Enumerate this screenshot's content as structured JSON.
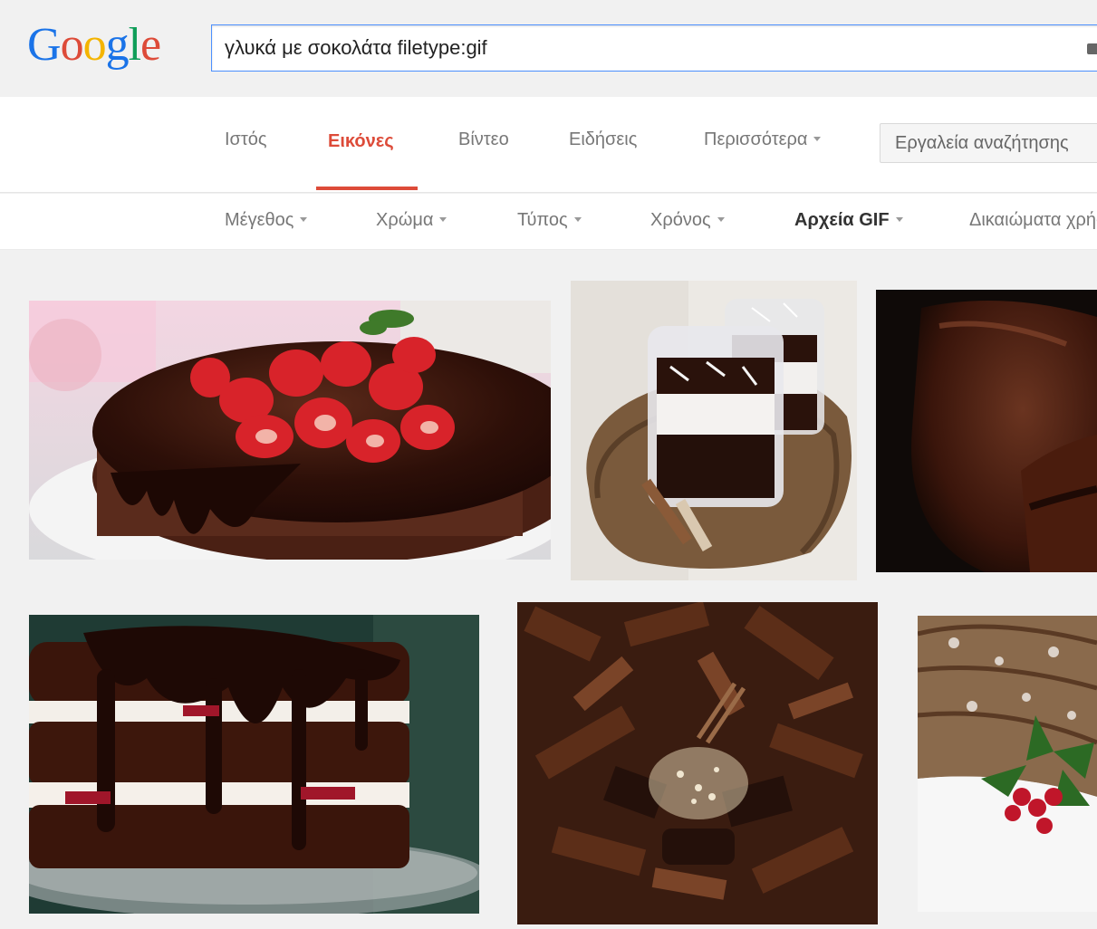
{
  "header": {
    "logo_letters": [
      "G",
      "o",
      "o",
      "g",
      "l",
      "e"
    ],
    "logo_colors": [
      "#1a73e8",
      "#dd4b39",
      "#f4b400",
      "#1a73e8",
      "#0f9d58",
      "#dd4b39"
    ],
    "search_query": "γλυκά με σοκολάτα filetype:gif"
  },
  "tabs": {
    "items": [
      {
        "label": "Ιστός"
      },
      {
        "label": "Εικόνες"
      },
      {
        "label": "Βίντεο"
      },
      {
        "label": "Ειδήσεις"
      },
      {
        "label": "Περισσότερα"
      }
    ],
    "active_index": 1,
    "tools_label": "Εργαλεία αναζήτησης"
  },
  "filters": {
    "items": [
      {
        "label": "Μέγεθος"
      },
      {
        "label": "Χρώμα"
      },
      {
        "label": "Τύπος"
      },
      {
        "label": "Χρόνος"
      },
      {
        "label": "Αρχεία GIF"
      },
      {
        "label": "Δικαιώματα χρήσης"
      }
    ]
  },
  "results": {
    "images": [
      {
        "icon": "chocolate-strawberry-cake-image"
      },
      {
        "icon": "chocolate-parfait-cups-image"
      },
      {
        "icon": "chocolate-glaze-closeup-image"
      },
      {
        "icon": "layered-chocolate-cream-cake-image"
      },
      {
        "icon": "chocolate-shavings-image"
      },
      {
        "icon": "yule-log-holly-image"
      }
    ]
  },
  "colors": {
    "accent_red": "#dd4b39",
    "search_border": "#4d90fe",
    "chocolate_dark": "#2a120b",
    "chocolate_mid": "#5a2e1c"
  }
}
